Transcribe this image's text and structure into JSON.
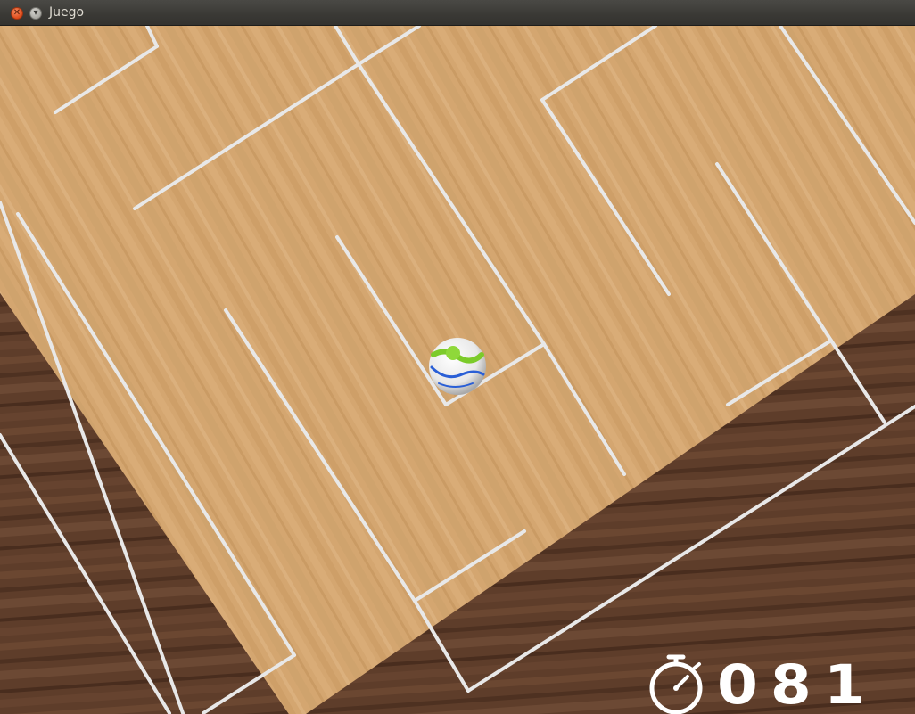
{
  "window": {
    "title": "Juego",
    "close_icon": "close-icon",
    "minimize_icon": "minimize-icon"
  },
  "game": {
    "timer_value": "081",
    "timer_icon": "stopwatch-icon",
    "colors": {
      "board_wood": "#d2a46c",
      "table_wood": "#5c3b28",
      "wall": "#e6e6e6",
      "ball_white": "#f2f2f2",
      "ball_green": "#7ccb2a",
      "ball_blue": "#2a5fd6"
    }
  }
}
